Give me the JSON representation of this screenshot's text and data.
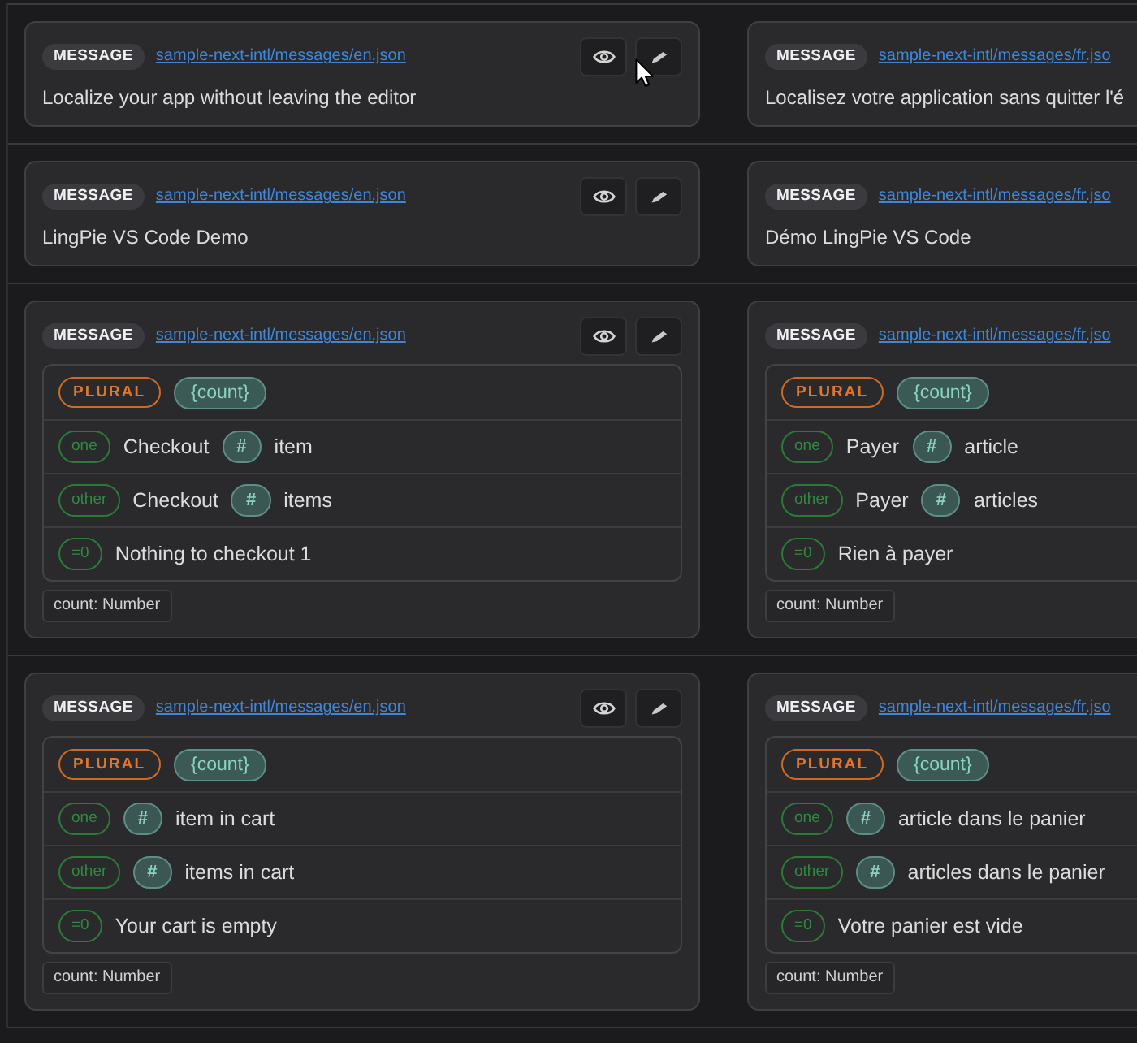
{
  "rows": [
    {
      "cells": [
        {
          "kind": "text",
          "badge": "MESSAGE",
          "file": "sample-next-intl/messages/en.json",
          "text": "Localize your app without leaving the editor"
        },
        {
          "kind": "text",
          "badge": "MESSAGE",
          "file": "sample-next-intl/messages/fr.jso",
          "text": "Localisez votre application sans quitter l'é"
        }
      ]
    },
    {
      "cells": [
        {
          "kind": "text",
          "badge": "MESSAGE",
          "file": "sample-next-intl/messages/en.json",
          "text": "LingPie VS Code Demo"
        },
        {
          "kind": "text",
          "badge": "MESSAGE",
          "file": "sample-next-intl/messages/fr.jso",
          "text": "Démo LingPie VS Code"
        }
      ]
    },
    {
      "cells": [
        {
          "kind": "plural",
          "badge": "MESSAGE",
          "file": "sample-next-intl/messages/en.json",
          "plural": {
            "type": "PLURAL",
            "variable": "{count}",
            "cases": [
              {
                "selector": "one",
                "parts": [
                  {
                    "kind": "text",
                    "text": "Checkout"
                  },
                  {
                    "kind": "hash",
                    "text": "#"
                  },
                  {
                    "kind": "text",
                    "text": "item"
                  }
                ]
              },
              {
                "selector": "other",
                "parts": [
                  {
                    "kind": "text",
                    "text": "Checkout"
                  },
                  {
                    "kind": "hash",
                    "text": "#"
                  },
                  {
                    "kind": "text",
                    "text": "items"
                  }
                ]
              },
              {
                "selector": "=0",
                "parts": [
                  {
                    "kind": "text",
                    "text": "Nothing to checkout 1"
                  }
                ]
              }
            ]
          },
          "type_hint": "count: Number"
        },
        {
          "kind": "plural",
          "badge": "MESSAGE",
          "file": "sample-next-intl/messages/fr.jso",
          "plural": {
            "type": "PLURAL",
            "variable": "{count}",
            "cases": [
              {
                "selector": "one",
                "parts": [
                  {
                    "kind": "text",
                    "text": "Payer"
                  },
                  {
                    "kind": "hash",
                    "text": "#"
                  },
                  {
                    "kind": "text",
                    "text": "article"
                  }
                ]
              },
              {
                "selector": "other",
                "parts": [
                  {
                    "kind": "text",
                    "text": "Payer"
                  },
                  {
                    "kind": "hash",
                    "text": "#"
                  },
                  {
                    "kind": "text",
                    "text": "articles"
                  }
                ]
              },
              {
                "selector": "=0",
                "parts": [
                  {
                    "kind": "text",
                    "text": "Rien à payer"
                  }
                ]
              }
            ]
          },
          "type_hint": "count: Number"
        }
      ]
    },
    {
      "cells": [
        {
          "kind": "plural",
          "badge": "MESSAGE",
          "file": "sample-next-intl/messages/en.json",
          "plural": {
            "type": "PLURAL",
            "variable": "{count}",
            "cases": [
              {
                "selector": "one",
                "parts": [
                  {
                    "kind": "hash",
                    "text": "#"
                  },
                  {
                    "kind": "text",
                    "text": "item in cart"
                  }
                ]
              },
              {
                "selector": "other",
                "parts": [
                  {
                    "kind": "hash",
                    "text": "#"
                  },
                  {
                    "kind": "text",
                    "text": "items in cart"
                  }
                ]
              },
              {
                "selector": "=0",
                "parts": [
                  {
                    "kind": "text",
                    "text": "Your cart is empty"
                  }
                ]
              }
            ]
          },
          "type_hint": "count: Number"
        },
        {
          "kind": "plural",
          "badge": "MESSAGE",
          "file": "sample-next-intl/messages/fr.jso",
          "plural": {
            "type": "PLURAL",
            "variable": "{count}",
            "cases": [
              {
                "selector": "one",
                "parts": [
                  {
                    "kind": "hash",
                    "text": "#"
                  },
                  {
                    "kind": "text",
                    "text": "article dans le panier"
                  }
                ]
              },
              {
                "selector": "other",
                "parts": [
                  {
                    "kind": "hash",
                    "text": "#"
                  },
                  {
                    "kind": "text",
                    "text": "articles dans le panier"
                  }
                ]
              },
              {
                "selector": "=0",
                "parts": [
                  {
                    "kind": "text",
                    "text": "Votre panier est vide"
                  }
                ]
              }
            ]
          },
          "type_hint": "count: Number"
        }
      ]
    }
  ]
}
